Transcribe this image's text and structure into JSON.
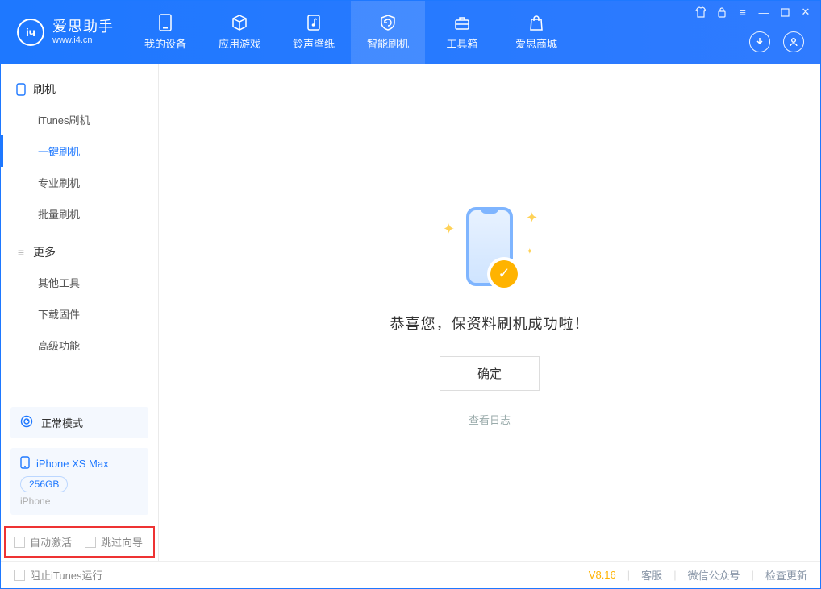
{
  "app": {
    "logo_title": "爱思助手",
    "logo_sub": "www.i4.cn"
  },
  "tabs": [
    {
      "label": "我的设备"
    },
    {
      "label": "应用游戏"
    },
    {
      "label": "铃声壁纸"
    },
    {
      "label": "智能刷机"
    },
    {
      "label": "工具箱"
    },
    {
      "label": "爱思商城"
    }
  ],
  "sidebar": {
    "section1_title": "刷机",
    "items1": [
      {
        "label": "iTunes刷机"
      },
      {
        "label": "一键刷机"
      },
      {
        "label": "专业刷机"
      },
      {
        "label": "批量刷机"
      }
    ],
    "section2_title": "更多",
    "items2": [
      {
        "label": "其他工具"
      },
      {
        "label": "下载固件"
      },
      {
        "label": "高级功能"
      }
    ],
    "mode_label": "正常模式",
    "device": {
      "name": "iPhone XS Max",
      "storage": "256GB",
      "type": "iPhone"
    },
    "checks": {
      "auto_activate": "自动激活",
      "skip_guide": "跳过向导"
    }
  },
  "main": {
    "message": "恭喜您，保资料刷机成功啦！",
    "ok_button": "确定",
    "view_log": "查看日志"
  },
  "footer": {
    "block_itunes": "阻止iTunes运行",
    "version": "V8.16",
    "support": "客服",
    "wechat": "微信公众号",
    "check_update": "检查更新"
  }
}
